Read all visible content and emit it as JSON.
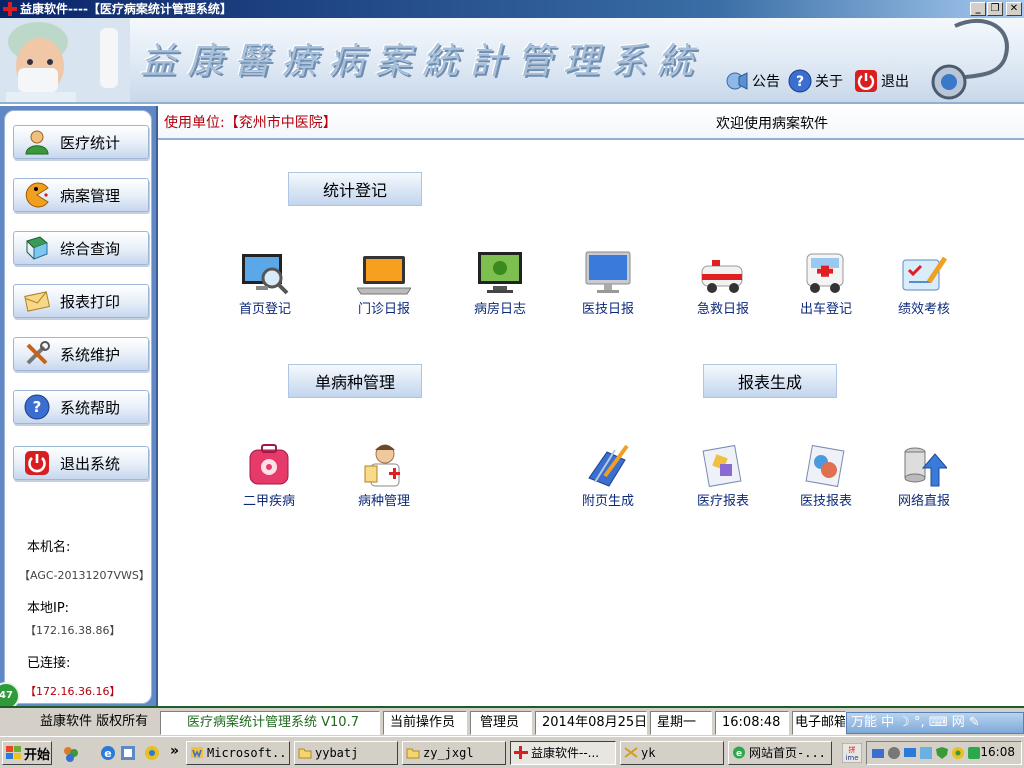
{
  "window": {
    "title": "益康软件----【医疗病案统计管理系统】",
    "controls": [
      "_",
      "❐",
      "✕"
    ]
  },
  "banner": {
    "brand_text": "益康醫療病案統計管理系統",
    "links": [
      {
        "label": "公告",
        "icon": "bulletin-icon"
      },
      {
        "label": "关于",
        "icon": "help-icon"
      },
      {
        "label": "退出",
        "icon": "power-icon"
      }
    ]
  },
  "sidebar": {
    "items": [
      {
        "label": "医疗统计",
        "icon": "user-icon"
      },
      {
        "label": "病案管理",
        "icon": "pacman-icon"
      },
      {
        "label": "综合查询",
        "icon": "book-icon"
      },
      {
        "label": "报表打印",
        "icon": "envelope-icon"
      },
      {
        "label": "系统维护",
        "icon": "tools-icon"
      },
      {
        "label": "系统帮助",
        "icon": "help-icon"
      },
      {
        "label": "退出系统",
        "icon": "power-icon"
      }
    ],
    "host_label": "本机名:",
    "host_value": "【AGC-20131207VWS】",
    "ip_label": "本地IP:",
    "ip_value": "【172.16.38.86】",
    "conn_label": "已连接:",
    "conn_value": "【172.16.36.16】"
  },
  "main": {
    "unit_label": "使用单位:【兖州市中医院】",
    "welcome": "欢迎使用病案软件",
    "sections": {
      "stats_register": "统计登记",
      "single_disease": "单病种管理",
      "report_gen": "报表生成"
    },
    "stats_tiles": [
      "首页登记",
      "门诊日报",
      "病房日志",
      "医技日报",
      "急救日报",
      "出车登记",
      "绩效考核"
    ],
    "disease_tiles": [
      "二甲疾病",
      "病种管理"
    ],
    "report_tiles": [
      "附页生成",
      "医疗报表",
      "医技报表",
      "网络直报"
    ]
  },
  "statusbar": {
    "copyright": "益康软件 版权所有",
    "system_name": "医疗病案统计管理系统 V10.7",
    "operator_label": "当前操作员",
    "operator": "管理员",
    "date": "2014年08月25日",
    "weekday": "星期一",
    "time": "16:08:48",
    "email": "电子邮箱",
    "ime_text": "万能 中 ☽ °, ⌨ 网 ✎",
    "badge": "47"
  },
  "taskbar": {
    "start": "开始",
    "tasks": [
      {
        "label": "Microsoft...",
        "icon": "word-icon"
      },
      {
        "label": "yybatj",
        "icon": "folder-icon"
      },
      {
        "label": "zy_jxgl",
        "icon": "folder-icon"
      },
      {
        "label": "益康软件--...",
        "icon": "app-icon"
      },
      {
        "label": "yk",
        "icon": "app-icon"
      },
      {
        "label": "网站首页-...",
        "icon": "ie-icon"
      }
    ],
    "clock": "16:08"
  },
  "colors": {
    "title_gradient_start": "#0a246a",
    "sidebar_frame": "#5f88c4",
    "unit_red": "#b3000c",
    "tile_label_blue": "#0d2a7a",
    "status_green": "#1e5c2c"
  }
}
